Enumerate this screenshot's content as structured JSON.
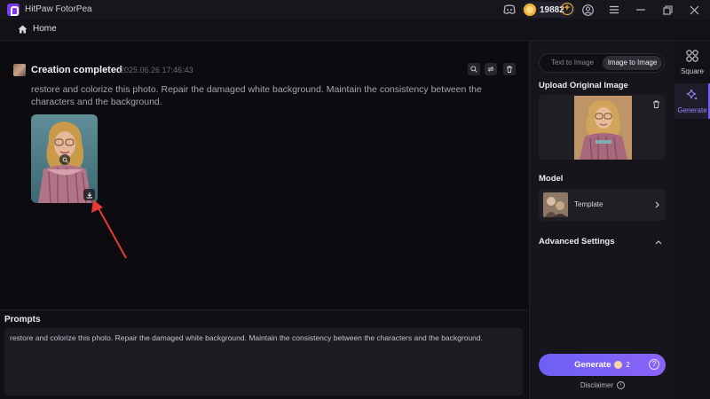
{
  "window": {
    "title": "HitPaw FotorPea",
    "credits": "19882",
    "plus_symbol": "+"
  },
  "nav": {
    "home_label": "Home"
  },
  "creation": {
    "status_title": "Creation completed",
    "timestamp": "2025.06.26  17:46:43",
    "prompt_text": "restore and colorize this photo. Repair the damaged white background. Maintain the consistency between the characters and the background."
  },
  "prompts": {
    "label": "Prompts",
    "value": "restore and colorize this photo. Repair the damaged white background. Maintain the consistency between the characters and the background."
  },
  "settings": {
    "tabs": [
      {
        "label": "Text to Image",
        "active": false
      },
      {
        "label": "Image to Image",
        "active": true
      }
    ],
    "upload_title": "Upload Original Image",
    "model_title": "Model",
    "model_name": "Template",
    "advanced_title": "Advanced Settings",
    "generate_label": "Generate",
    "generate_cost": "2",
    "help_symbol": "?",
    "disclaimer": "Disclaimer",
    "info_symbol": "i"
  },
  "side_nav": {
    "items": [
      {
        "label": "Square",
        "active": false
      },
      {
        "label": "Generate",
        "active": true
      }
    ]
  },
  "colors": {
    "accent": "#7c5cff",
    "annotation_arrow": "#e53935",
    "coin": "#f5b335"
  },
  "icons": [
    "app-logo-icon",
    "discord-icon",
    "coin-icon",
    "plus-icon",
    "user-icon",
    "menu-icon",
    "minimize-icon",
    "restore-icon",
    "close-icon",
    "home-icon",
    "zoom-icon",
    "regenerate-icon",
    "delete-icon",
    "download-icon",
    "trash-icon",
    "chevron-right-icon",
    "chevron-up-icon",
    "help-icon",
    "info-icon",
    "square-icon",
    "sparkle-icon"
  ]
}
